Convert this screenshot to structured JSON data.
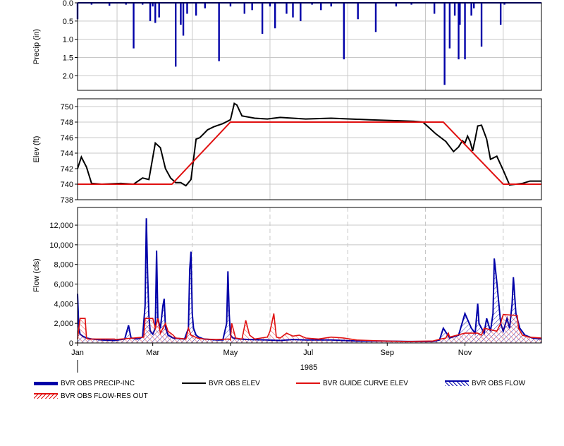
{
  "chart_data": [
    {
      "type": "bar",
      "ylabel": "Precip (in)",
      "ylim": [
        0,
        2.4
      ],
      "inverted": true,
      "yticks": [
        "0.0",
        "0.5",
        "1.0",
        "1.5",
        "2.0"
      ],
      "ytick_values": [
        0,
        0.5,
        1.0,
        1.5,
        2.0
      ],
      "series": [
        {
          "name": "BVR OBS PRECIP-INC",
          "color": "#0000a8",
          "day_of_year": [
            1,
            12,
            26,
            39,
            45,
            52,
            58,
            60,
            62,
            65,
            78,
            82,
            84,
            87,
            94,
            101,
            112,
            121,
            132,
            138,
            146,
            152,
            156,
            165,
            170,
            176,
            185,
            192,
            200,
            210,
            221,
            235,
            251,
            263,
            281,
            289,
            293,
            297,
            300,
            301,
            305,
            310,
            312,
            318,
            333,
            336
          ],
          "values": [
            0.45,
            0.05,
            0.08,
            0.05,
            1.25,
            0.05,
            0.5,
            0.1,
            0.55,
            0.4,
            1.75,
            0.6,
            0.9,
            0.3,
            0.35,
            0.15,
            1.6,
            0.1,
            0.3,
            0.2,
            0.85,
            0.1,
            0.7,
            0.3,
            0.4,
            0.5,
            0.05,
            0.2,
            0.1,
            1.55,
            0.45,
            0.8,
            0.1,
            0.05,
            0.3,
            2.25,
            1.25,
            0.35,
            1.55,
            0.6,
            1.55,
            0.35,
            0.15,
            1.2,
            0.6,
            0.05
          ]
        }
      ]
    },
    {
      "type": "line",
      "ylabel": "Elev (ft)",
      "ylim": [
        738,
        751
      ],
      "yticks": [
        "738",
        "740",
        "742",
        "744",
        "746",
        "748",
        "750"
      ],
      "ytick_values": [
        738,
        740,
        742,
        744,
        746,
        748,
        750
      ],
      "series": [
        {
          "name": "BVR OBS ELEV",
          "color": "#000000",
          "day_of_year": [
            1,
            4,
            8,
            12,
            20,
            35,
            45,
            52,
            57,
            62,
            66,
            70,
            74,
            78,
            82,
            86,
            90,
            94,
            97,
            100,
            103,
            108,
            115,
            121,
            124,
            126,
            130,
            140,
            150,
            160,
            180,
            200,
            230,
            265,
            272,
            282,
            290,
            296,
            300,
            303,
            305,
            307,
            309,
            311,
            313,
            315,
            318,
            322,
            325,
            330,
            335,
            340,
            345,
            350,
            356,
            362,
            365
          ],
          "values": [
            742.0,
            743.5,
            742.2,
            740.1,
            740.0,
            740.1,
            740.0,
            740.8,
            740.6,
            745.3,
            744.7,
            742.0,
            740.8,
            740.2,
            740.2,
            739.8,
            740.6,
            745.8,
            746.0,
            746.5,
            747.0,
            747.4,
            747.8,
            748.3,
            750.4,
            750.2,
            748.8,
            748.5,
            748.4,
            748.6,
            748.4,
            748.5,
            748.3,
            748.1,
            748.0,
            746.5,
            745.5,
            744.2,
            744.8,
            745.6,
            745.3,
            746.2,
            745.5,
            744.3,
            745.8,
            747.5,
            747.6,
            745.8,
            743.2,
            743.6,
            741.8,
            739.9,
            740.0,
            740.1,
            740.4,
            740.4,
            740.4
          ]
        },
        {
          "name": "BVR GUIDE CURVE ELEV",
          "color": "#e01010",
          "day_of_year": [
            1,
            75,
            121,
            288,
            335,
            365
          ],
          "values": [
            740,
            740,
            748,
            748,
            740,
            740
          ]
        }
      ]
    },
    {
      "type": "area",
      "ylabel": "Flow (cfs)",
      "xlabel": "1985",
      "ylim": [
        0,
        13800
      ],
      "yticks": [
        "0",
        "2,000",
        "4,000",
        "6,000",
        "8,000",
        "10,000",
        "12,000"
      ],
      "ytick_values": [
        0,
        2000,
        4000,
        6000,
        8000,
        10000,
        12000
      ],
      "xticks": [
        "Jan",
        "Mar",
        "May",
        "Jul",
        "Sep",
        "Nov"
      ],
      "xtick_days": [
        1,
        60,
        121,
        182,
        244,
        305
      ],
      "grid_days": [
        32,
        91,
        152,
        213,
        274,
        335
      ],
      "series": [
        {
          "name": "BVR OBS FLOW",
          "color": "#0000a8",
          "day_of_year": [
            1,
            2,
            3,
            5,
            8,
            12,
            20,
            30,
            38,
            41,
            43,
            48,
            52,
            54,
            55,
            56,
            57,
            58,
            60,
            62,
            63,
            64,
            66,
            68,
            69,
            70,
            72,
            76,
            85,
            88,
            89,
            90,
            91,
            92,
            94,
            96,
            100,
            110,
            115,
            118,
            119,
            120,
            121,
            123,
            128,
            135,
            150,
            160,
            170,
            180,
            190,
            200,
            210,
            220,
            240,
            260,
            280,
            285,
            288,
            293,
            300,
            305,
            310,
            313,
            315,
            316,
            318,
            320,
            322,
            325,
            327,
            328,
            330,
            333,
            335,
            338,
            340,
            342,
            343,
            345,
            348,
            352,
            358,
            365
          ],
          "values": [
            5000,
            1500,
            900,
            700,
            500,
            400,
            300,
            250,
            400,
            1800,
            500,
            400,
            600,
            3800,
            12700,
            7000,
            2800,
            1200,
            900,
            1500,
            9400,
            2500,
            1500,
            3800,
            4500,
            1600,
            800,
            500,
            400,
            1500,
            7500,
            9300,
            3000,
            1500,
            800,
            600,
            400,
            300,
            300,
            2000,
            7300,
            3000,
            800,
            500,
            400,
            350,
            300,
            250,
            350,
            300,
            300,
            300,
            250,
            200,
            200,
            150,
            150,
            300,
            1500,
            500,
            800,
            3000,
            1500,
            1000,
            4000,
            2000,
            1500,
            1000,
            2500,
            1200,
            3000,
            8600,
            6200,
            2000,
            1200,
            2500,
            1500,
            4000,
            6700,
            3000,
            1500,
            800,
            500,
            400
          ]
        },
        {
          "name": "BVR OBS FLOW-RES OUT",
          "color": "#e01010",
          "day_of_year": [
            1,
            3,
            7,
            8,
            9,
            30,
            31,
            45,
            53,
            54,
            60,
            62,
            64,
            66,
            68,
            70,
            72,
            76,
            78,
            86,
            88,
            90,
            95,
            100,
            110,
            120,
            121,
            122,
            125,
            130,
            133,
            136,
            140,
            145,
            150,
            152,
            155,
            157,
            160,
            165,
            170,
            175,
            180,
            190,
            200,
            210,
            220,
            240,
            260,
            280,
            286,
            290,
            292,
            293,
            305,
            315,
            318,
            320,
            330,
            333,
            334,
            335,
            346,
            347,
            350,
            355,
            365
          ],
          "values": [
            400,
            2500,
            2500,
            500,
            400,
            400,
            350,
            500,
            600,
            2500,
            2500,
            1500,
            2500,
            1000,
            1500,
            2000,
            1200,
            800,
            500,
            400,
            1500,
            800,
            500,
            400,
            350,
            400,
            300,
            2000,
            500,
            400,
            2300,
            800,
            400,
            500,
            600,
            1200,
            3000,
            600,
            500,
            1000,
            700,
            800,
            500,
            400,
            600,
            500,
            300,
            200,
            150,
            200,
            400,
            500,
            1000,
            600,
            1000,
            1000,
            800,
            1500,
            1200,
            2000,
            2500,
            2900,
            2800,
            1500,
            800,
            600,
            500
          ]
        }
      ]
    }
  ],
  "legend": [
    {
      "label": "BVR OBS PRECIP-INC",
      "style": "thick-bar",
      "color": "#0000a8"
    },
    {
      "label": "BVR OBS ELEV",
      "style": "line",
      "color": "#000000"
    },
    {
      "label": "BVR GUIDE CURVE ELEV",
      "style": "line",
      "color": "#e01010"
    },
    {
      "label": "BVR OBS FLOW",
      "style": "hatch",
      "color": "#0000a8"
    },
    {
      "label": "BVR OBS FLOW-RES OUT",
      "style": "hatch",
      "color": "#e01010"
    }
  ]
}
